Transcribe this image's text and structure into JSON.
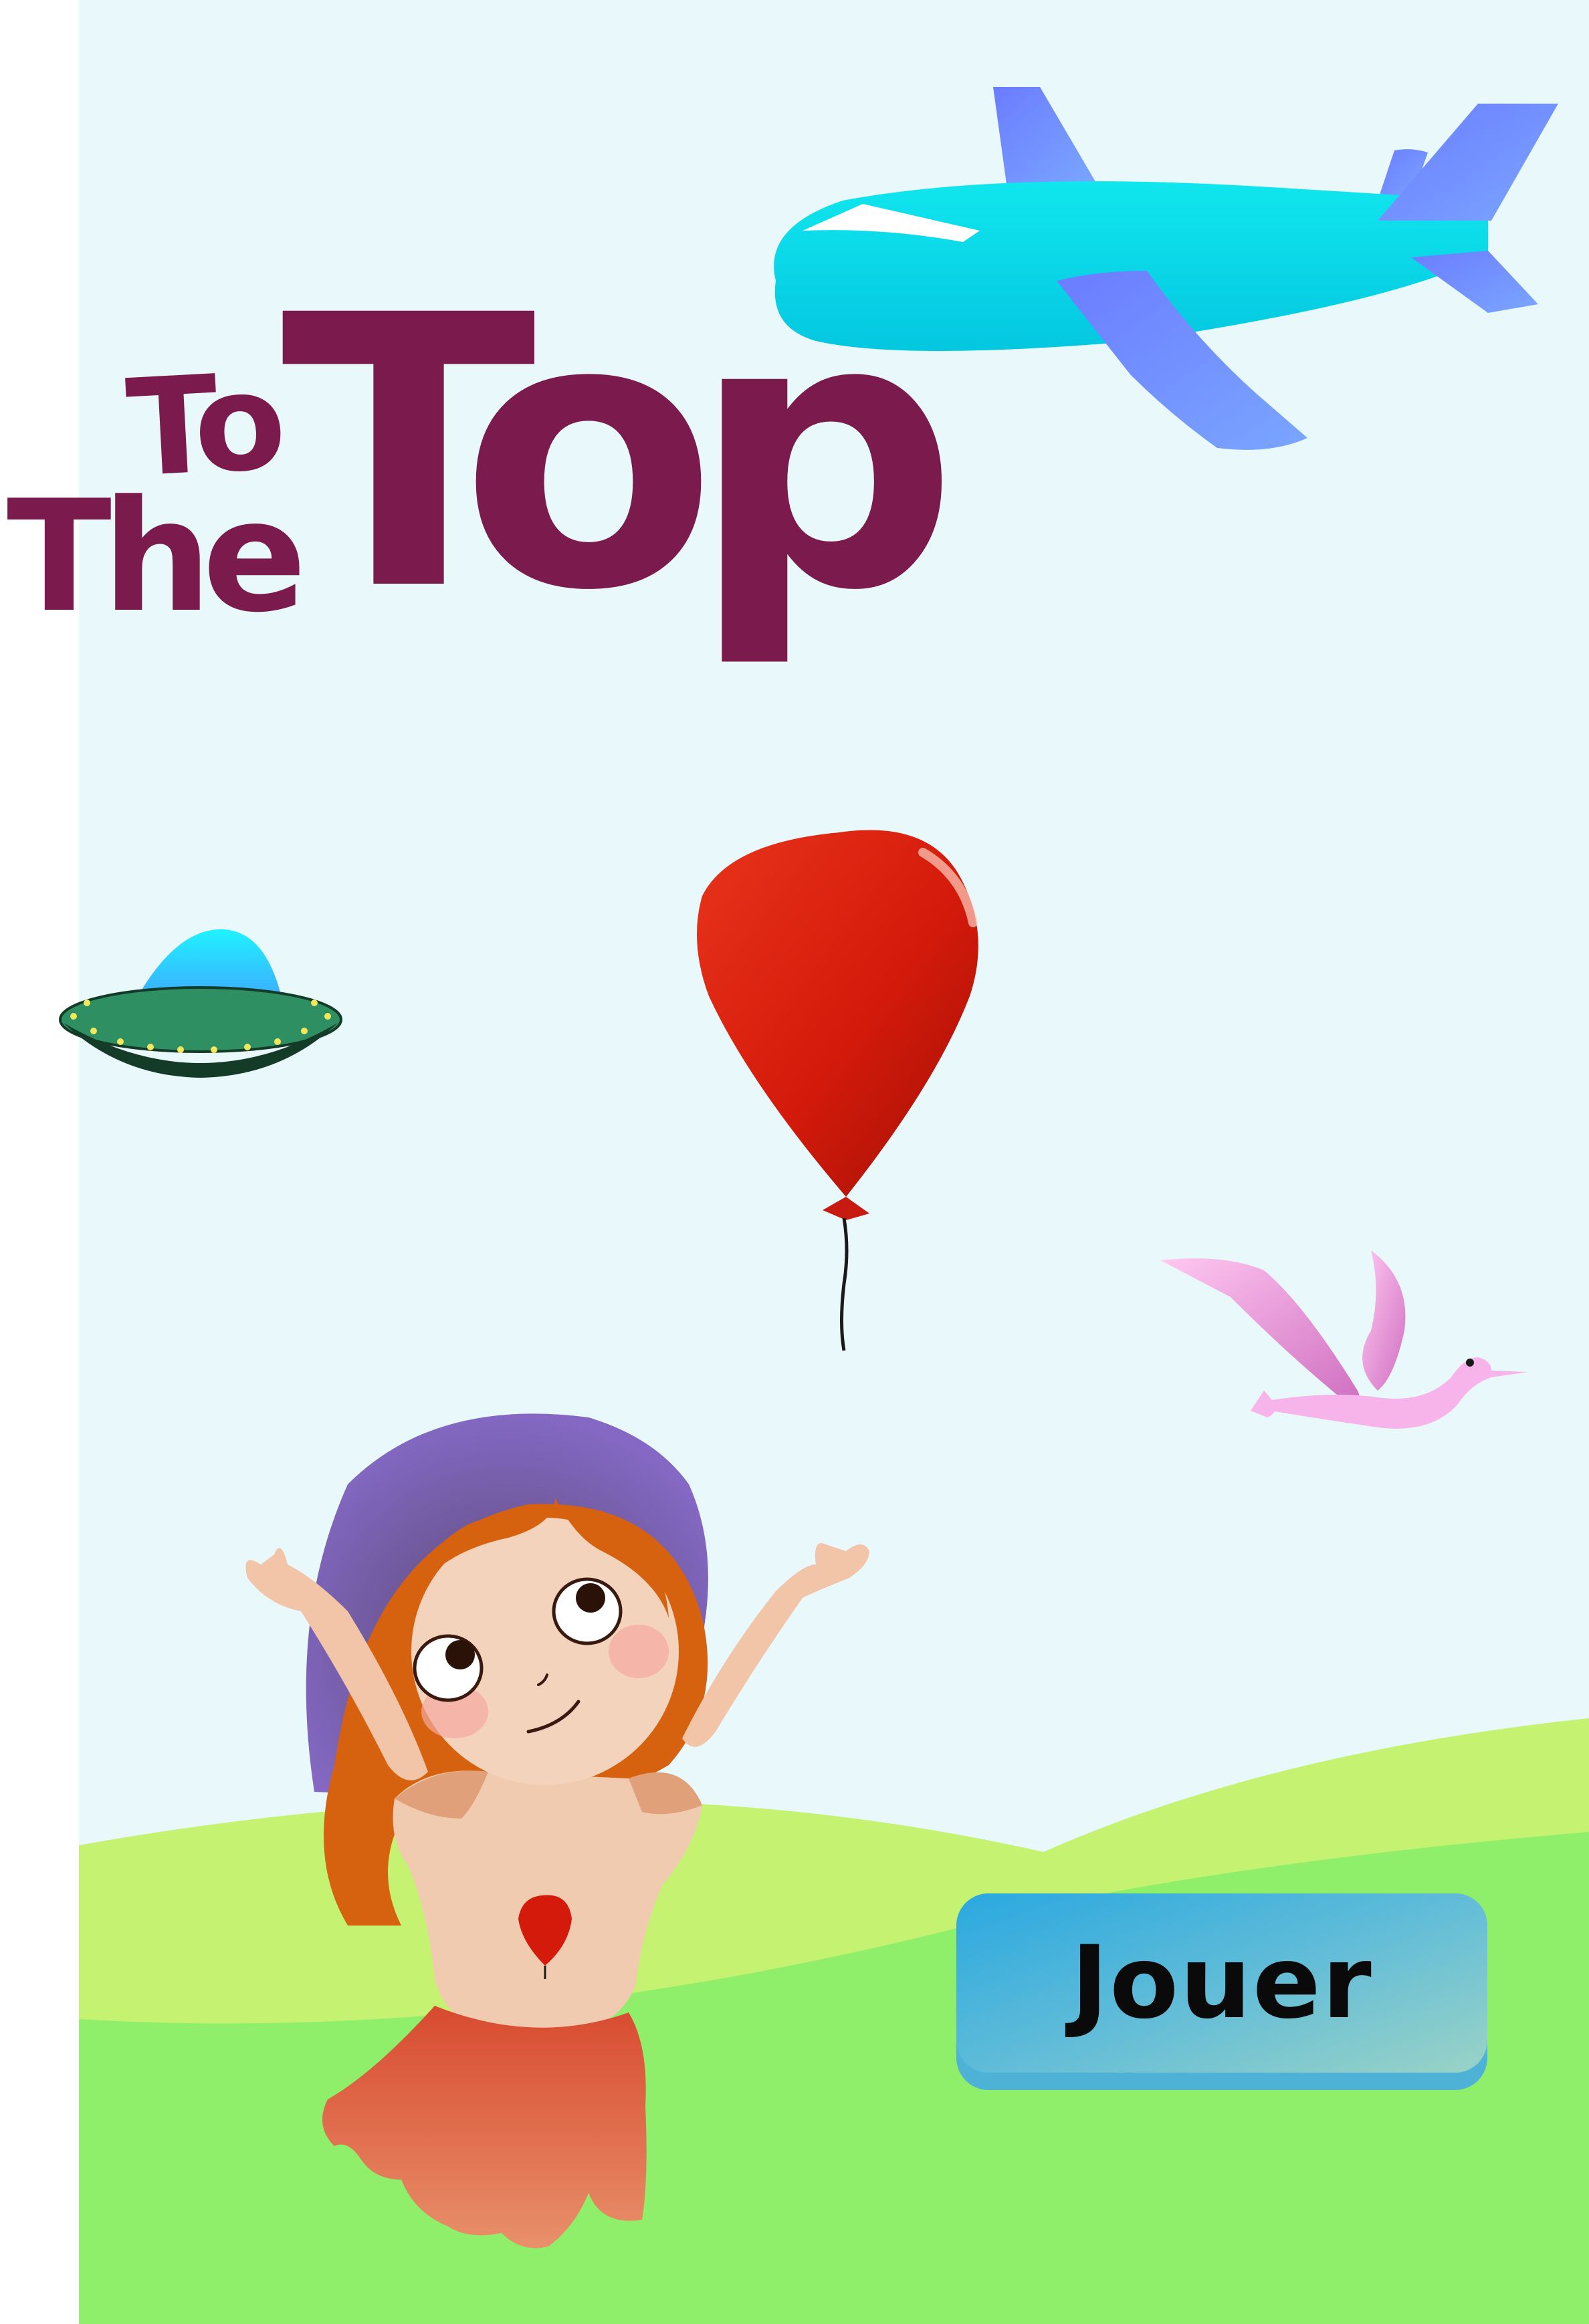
{
  "game": {
    "title_line_to": "To",
    "title_line_the": "The",
    "title_line_top": "Top",
    "play_button_label": "Jouer"
  },
  "colors": {
    "sky": "#e8f8fb",
    "grass_back": "#c5f371",
    "grass_front": "#8fef6a",
    "title": "#7a1a4d",
    "button": "#4db2d6",
    "balloon": "#d41a0a",
    "plane_body": "#00e1e8",
    "plane_wing": "#7290ff",
    "ufo_dome": "#2ec3ff",
    "ufo_saucer": "#2e8f63",
    "bird": "#f3b6e6",
    "hat": "#7a5fb8",
    "hair": "#d6620f"
  },
  "icons": [
    "airplane-icon",
    "balloon-icon",
    "ufo-icon",
    "bird-icon",
    "girl-character"
  ]
}
